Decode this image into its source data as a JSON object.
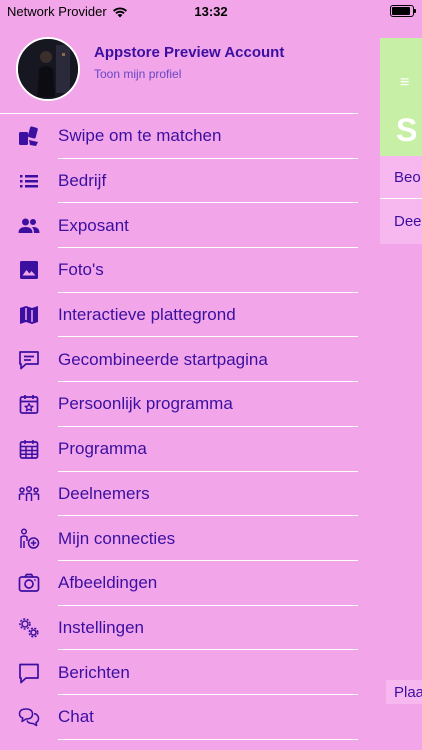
{
  "status_bar": {
    "carrier": "Network Provider",
    "time": "13:32"
  },
  "profile": {
    "name": "Appstore Preview Account",
    "subtitle": "Toon mijn profiel"
  },
  "menu": {
    "items": [
      {
        "label": "Swipe om te matchen",
        "icon": "swipe-cards-icon"
      },
      {
        "label": "Bedrijf",
        "icon": "list-icon"
      },
      {
        "label": "Exposant",
        "icon": "people-icon"
      },
      {
        "label": "Foto's",
        "icon": "image-icon"
      },
      {
        "label": "Interactieve plattegrond",
        "icon": "map-icon"
      },
      {
        "label": "Gecombineerde startpagina",
        "icon": "message-square-icon"
      },
      {
        "label": "Persoonlijk programma",
        "icon": "calendar-star-icon"
      },
      {
        "label": "Programma",
        "icon": "calendar-grid-icon"
      },
      {
        "label": "Deelnemers",
        "icon": "group-icon"
      },
      {
        "label": "Mijn connecties",
        "icon": "person-add-icon"
      },
      {
        "label": "Afbeeldingen",
        "icon": "camera-icon"
      },
      {
        "label": "Instellingen",
        "icon": "gears-icon"
      },
      {
        "label": "Berichten",
        "icon": "speech-bubble-icon"
      },
      {
        "label": "Chat",
        "icon": "chat-bubbles-icon"
      }
    ]
  },
  "background_panel": {
    "menu_glyph": "≡",
    "title": "S",
    "rows": [
      "Beo",
      "Dee"
    ],
    "bottom_button": "Plaa"
  },
  "colors": {
    "background": "#f2a6e9",
    "text": "#3b0fa0",
    "header_green": "#c8efa6",
    "divider": "#ffffff"
  }
}
